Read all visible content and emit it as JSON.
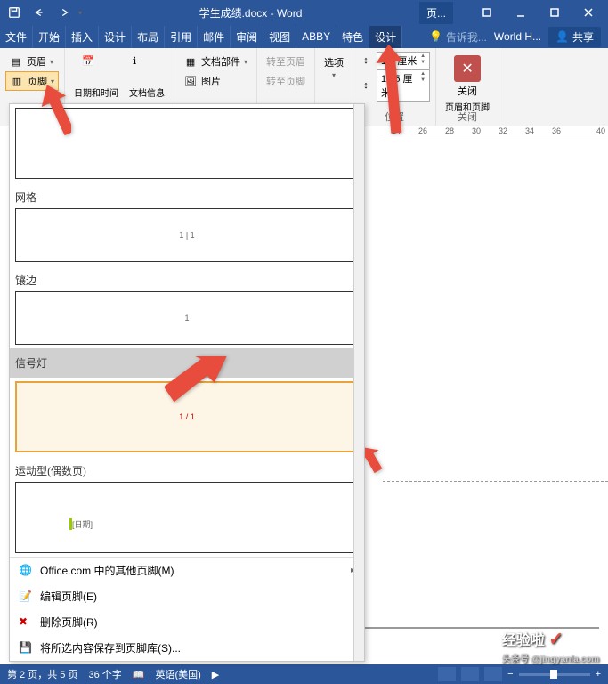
{
  "titlebar": {
    "doc_title": "学生成绩.docx - Word",
    "context_tab": "页..."
  },
  "tabs": {
    "file": "文件",
    "home": "开始",
    "insert": "插入",
    "design": "设计",
    "layout": "布局",
    "references": "引用",
    "mail": "邮件",
    "review": "审阅",
    "view": "视图",
    "abby": "ABBY",
    "special": "特色",
    "design2": "设计",
    "tell_me": "告诉我...",
    "world": "World H...",
    "share": "共享"
  },
  "ribbon": {
    "header": "页眉",
    "footer": "页脚",
    "date_time": "日期和时间",
    "doc_info": "文档信息",
    "doc_parts": "文档部件",
    "picture": "图片",
    "goto_header": "转至页眉",
    "goto_footer": "转至页脚",
    "options": "选项",
    "top_margin": "1.5 厘米",
    "bottom_margin": "1.75 厘米",
    "position": "位置",
    "close_label1": "关闭",
    "close_label2": "页眉和页脚",
    "close_group": "关闭"
  },
  "dropdown": {
    "grid": "网格",
    "grid_text": "1 | 1",
    "border": "镶边",
    "border_text": "1",
    "signal": "信号灯",
    "signal_text": "1 / 1",
    "sport": "运动型(偶数页)",
    "sport_text": "[日期]",
    "office_more": "Office.com 中的其他页脚(M)",
    "edit_footer": "编辑页脚(E)",
    "delete_footer": "删除页脚(R)",
    "save_to_gallery": "将所选内容保存到页脚库(S)..."
  },
  "ruler": {
    "t24": "24",
    "t26": "26",
    "t28": "28",
    "t30": "30",
    "t32": "32",
    "t34": "34",
    "t36": "36",
    "t40": "40"
  },
  "statusbar": {
    "page": "第 2 页，共 5 页",
    "words": "36 个字",
    "lang": "英语(美国)"
  },
  "watermark": {
    "main": "经验啦",
    "sub": "头条号 @jingyanla.com"
  }
}
